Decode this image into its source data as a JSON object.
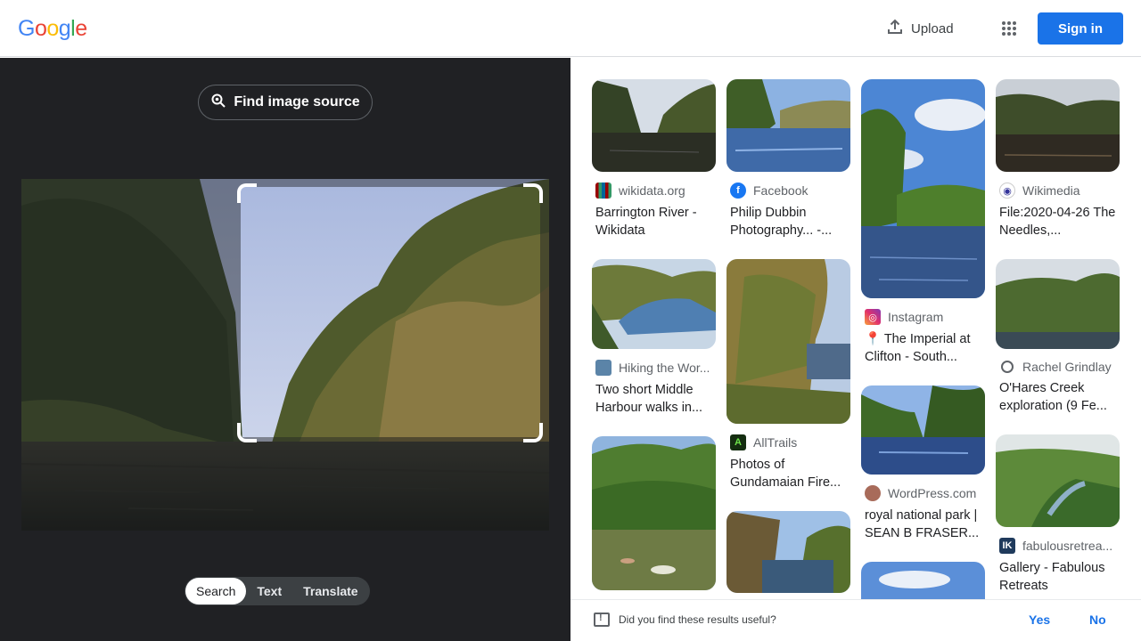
{
  "header": {
    "logo_letters": [
      {
        "char": "G",
        "color": "#4285F4"
      },
      {
        "char": "o",
        "color": "#EA4335"
      },
      {
        "char": "o",
        "color": "#FBBC05"
      },
      {
        "char": "g",
        "color": "#4285F4"
      },
      {
        "char": "l",
        "color": "#34A853"
      },
      {
        "char": "e",
        "color": "#EA4335"
      }
    ],
    "upload_label": "Upload",
    "upload_icon": "upload-icon",
    "apps_icon": "apps-grid-icon",
    "signin_label": "Sign in",
    "accent_color": "#1a73e8"
  },
  "lens": {
    "find_source_label": "Find image source",
    "find_source_icon": "lens-search-icon",
    "modes": [
      "Search",
      "Text",
      "Translate"
    ],
    "active_mode": "Search"
  },
  "results": {
    "columns": [
      [
        {
          "source": "wikidata.org",
          "favicon": "wikidata-icon",
          "title": "Barrington River - Wikidata"
        },
        {
          "source": "Hiking the Wor...",
          "favicon": "hiking-site-icon",
          "title": "Two short Middle Harbour walks in..."
        },
        {
          "source": "",
          "favicon": "",
          "title": ""
        }
      ],
      [
        {
          "source": "Facebook",
          "favicon": "facebook-icon",
          "title": "Philip Dubbin Photography... -..."
        },
        {
          "source": "AllTrails",
          "favicon": "alltrails-icon",
          "title": "Photos of Gundamaian Fire..."
        },
        {
          "source": "",
          "favicon": "",
          "title": ""
        }
      ],
      [
        {
          "source": "Instagram",
          "favicon": "instagram-icon",
          "title": "📍 The Imperial at Clifton - South..."
        },
        {
          "source": "WordPress.com",
          "favicon": "wordpress-icon",
          "title": "royal national park | SEAN B FRASER..."
        },
        {
          "source": "",
          "favicon": "",
          "title": ""
        }
      ],
      [
        {
          "source": "Wikimedia",
          "favicon": "wikimedia-icon",
          "title": "File:2020-04-26 The Needles,..."
        },
        {
          "source": "Rachel Grindlay",
          "favicon": "globe-icon",
          "title": "O'Hares Creek exploration (9 Fe..."
        },
        {
          "source": "fabulousretrea...",
          "favicon": "fabulous-retreats-icon",
          "title": "Gallery - Fabulous Retreats"
        }
      ]
    ]
  },
  "feedback": {
    "question": "Did you find these results useful?",
    "yes_label": "Yes",
    "no_label": "No"
  }
}
